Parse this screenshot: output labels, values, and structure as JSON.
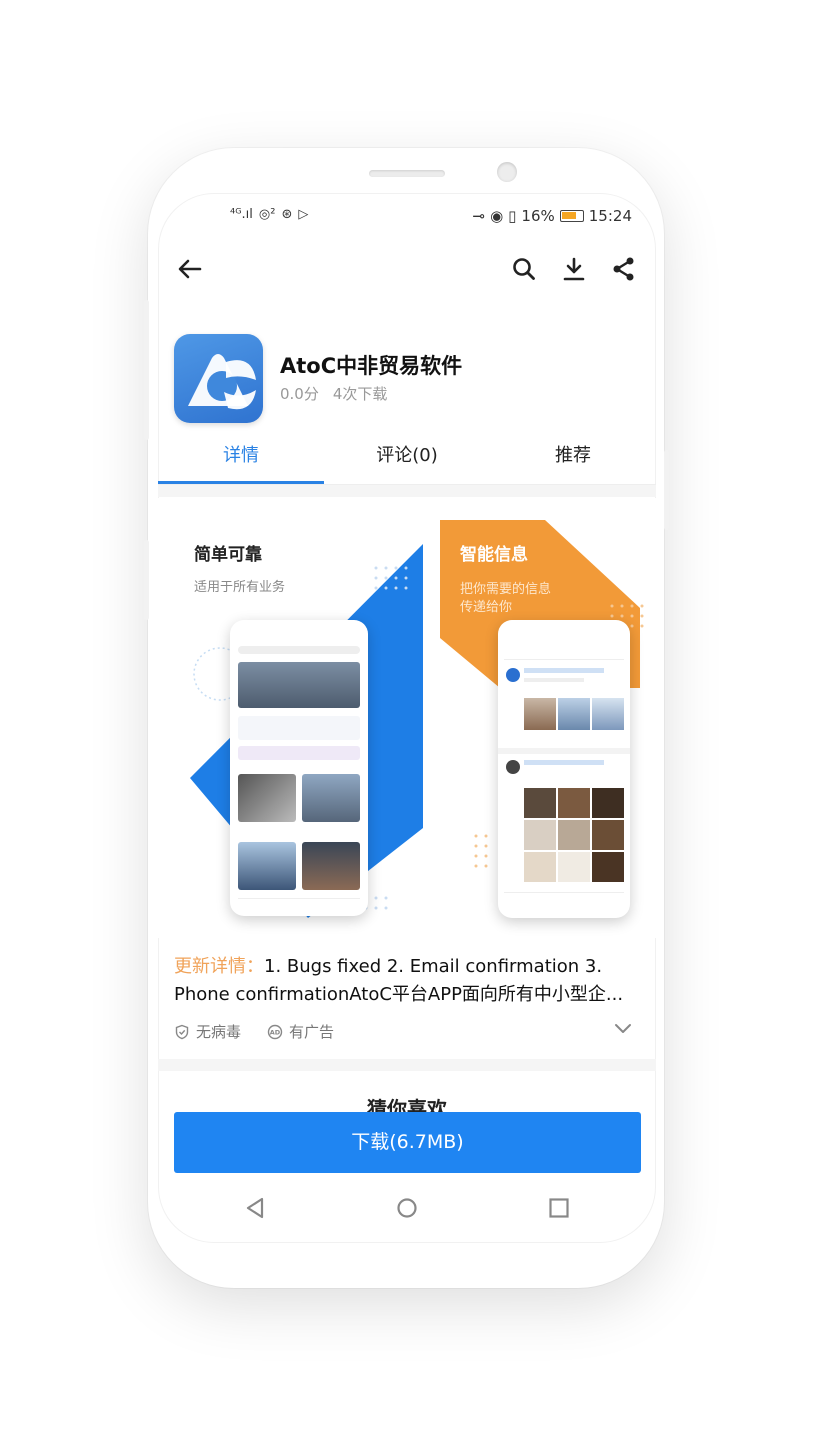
{
  "status": {
    "signal_left": "⁴ᴳ.ıl",
    "battery_pct": "16%",
    "time": "15:24"
  },
  "toolbar": {
    "back_icon": "back-arrow-icon",
    "search_icon": "search-icon",
    "download_icon": "download-icon",
    "share_icon": "share-icon"
  },
  "app": {
    "name": "AtoC中非贸易软件",
    "rating": "0.0分",
    "downloads": "4次下载"
  },
  "tabs": [
    {
      "label": "详情",
      "active": true
    },
    {
      "label": "评论(0)",
      "active": false
    },
    {
      "label": "推荐",
      "active": false
    }
  ],
  "screenshots": [
    {
      "title": "简单可靠",
      "subtitle": "适用于所有业务",
      "accent": "#1e7ee6"
    },
    {
      "title": "智能信息",
      "subtitle_line1": "把你需要的信息",
      "subtitle_line2": "传递给你",
      "accent": "#f29a38"
    }
  ],
  "details": {
    "label": "更新详情：",
    "text_line1": "1. Bugs fixed 2. Email confirmation 3.",
    "text_line2": "Phone confirmationAtoC平台APP面向所有中小型企..."
  },
  "badges": {
    "virus": "无病毒",
    "ads": "有广告"
  },
  "guess": {
    "title": "猜你喜欢"
  },
  "download_button": "下载(6.7MB)",
  "colors": {
    "accent": "#2a82e4",
    "button": "#1f85f2",
    "label_orange": "#f0a35a"
  }
}
